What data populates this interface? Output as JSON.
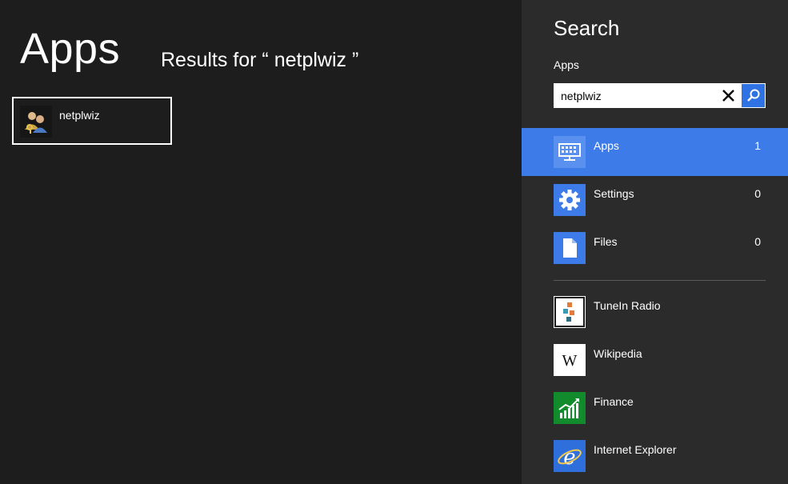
{
  "main": {
    "title": "Apps",
    "results_for": "Results for “ netplwiz ”",
    "results": [
      {
        "label": "netplwiz",
        "icon": "users-icon"
      }
    ]
  },
  "search_pane": {
    "title": "Search",
    "scope": "Apps",
    "query": "netplwiz",
    "categories": [
      {
        "label": "Apps",
        "count": "1",
        "icon": "apps-keyboard-icon",
        "selected": true
      },
      {
        "label": "Settings",
        "count": "0",
        "icon": "gear-icon",
        "selected": false
      },
      {
        "label": "Files",
        "count": "0",
        "icon": "file-icon",
        "selected": false
      }
    ],
    "apps": [
      {
        "label": "TuneIn Radio",
        "icon": "tunein-icon",
        "color": "#ffffff"
      },
      {
        "label": "Wikipedia",
        "icon": "wikipedia-icon",
        "color": "#ffffff"
      },
      {
        "label": "Finance",
        "icon": "finance-chart-icon",
        "color": "#128b2d"
      },
      {
        "label": "Internet Explorer",
        "icon": "internet-explorer-icon",
        "color": "#2e6fdb"
      }
    ]
  },
  "colors": {
    "background": "#1d1d1d",
    "pane": "#2b2b2b",
    "accent": "#3c7be8"
  }
}
